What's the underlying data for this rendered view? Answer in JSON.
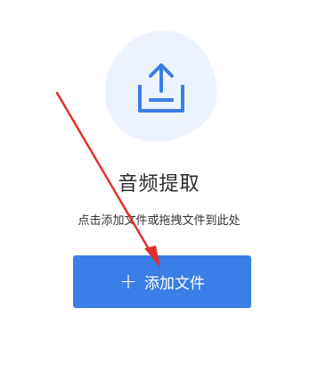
{
  "title": "音频提取",
  "hint": "点击添加文件或拖拽文件到此处",
  "add_button": {
    "icon": "plus-icon",
    "label": "添加文件"
  },
  "colors": {
    "accent": "#3a7ee8",
    "blob": "#edf3fe",
    "annotation": "#e0322a"
  }
}
